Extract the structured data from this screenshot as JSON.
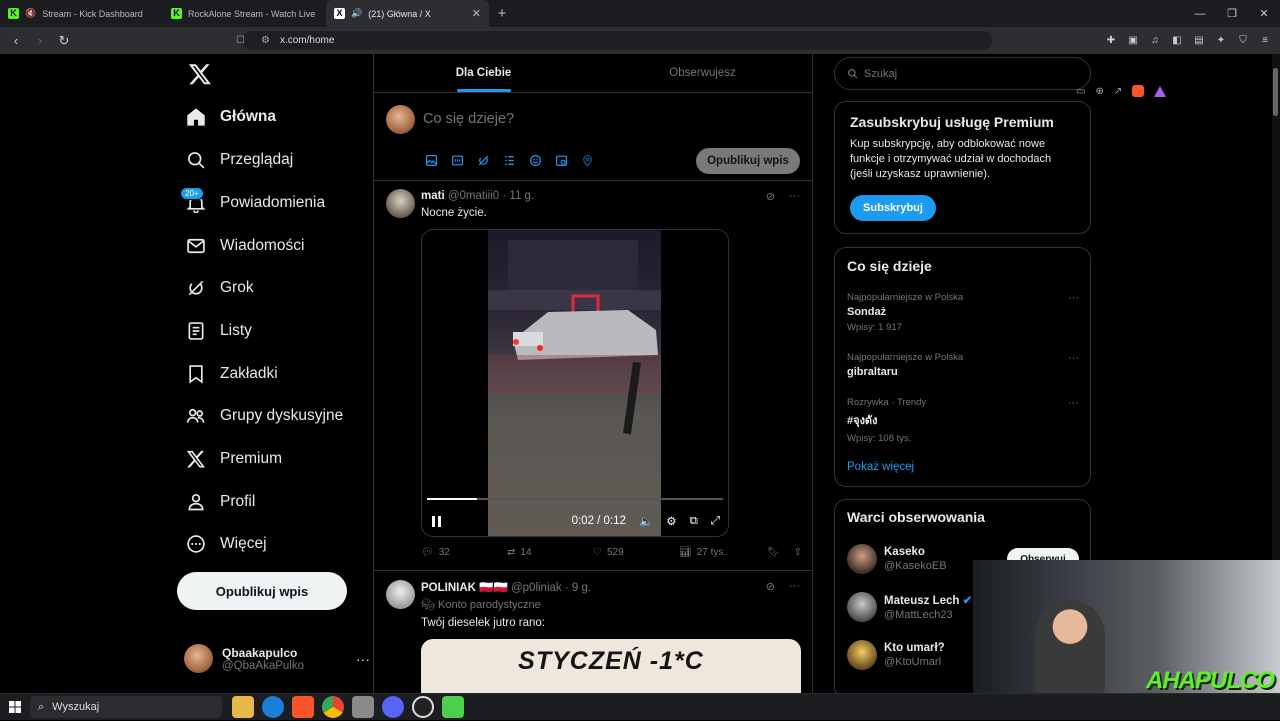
{
  "browser": {
    "tabs": [
      {
        "title": "Stream - Kick Dashboard",
        "active": false
      },
      {
        "title": "RockAlone Stream - Watch Live on K",
        "active": false
      },
      {
        "title": "(21) Główna / X",
        "active": true
      }
    ],
    "url": "x.com/home"
  },
  "sidebar": {
    "items": [
      {
        "label": "Główna",
        "icon": "home-icon"
      },
      {
        "label": "Przeglądaj",
        "icon": "search-icon"
      },
      {
        "label": "Powiadomienia",
        "icon": "bell-icon",
        "badge": "20+"
      },
      {
        "label": "Wiadomości",
        "icon": "mail-icon"
      },
      {
        "label": "Grok",
        "icon": "grok-icon"
      },
      {
        "label": "Listy",
        "icon": "list-icon"
      },
      {
        "label": "Zakładki",
        "icon": "bookmark-icon"
      },
      {
        "label": "Grupy dyskusyjne",
        "icon": "people-icon"
      },
      {
        "label": "Premium",
        "icon": "x-logo-icon"
      },
      {
        "label": "Profil",
        "icon": "person-icon"
      },
      {
        "label": "Więcej",
        "icon": "more-circle-icon"
      }
    ],
    "post_button": "Opublikuj wpis",
    "account": {
      "name": "Qbaakapulco",
      "handle": "@QbaAkaPulko"
    }
  },
  "feed": {
    "tabs": [
      "Dla Ciebie",
      "Obserwujesz"
    ],
    "composer": {
      "placeholder": "Co się dzieje?",
      "post_button": "Opublikuj wpis"
    },
    "tweets": [
      {
        "name": "mati",
        "handle": "@0matiii0",
        "time": "· 11 g.",
        "text": "Nocne życie.",
        "video": {
          "time": "0:02 / 0:12",
          "progress": 0.17
        },
        "stats": {
          "replies": "32",
          "reposts": "14",
          "likes": "529",
          "views": "27 tys."
        }
      },
      {
        "name": "POLINIAK 🇵🇱🇵🇱",
        "handle": "@p0liniak",
        "time": "· 9 g.",
        "label": "Konto parodystyczne",
        "text": "Twój dieselek jutro rano:",
        "image_text": "STYCZEŃ -1*C"
      }
    ]
  },
  "rightbar": {
    "search_placeholder": "Szukaj",
    "premium": {
      "title": "Zasubskrybuj usługę Premium",
      "body": "Kup subskrypcję, aby odblokować nowe funkcje i otrzymywać udział w dochodach (jeśli uzyskasz uprawnienie).",
      "button": "Subskrybuj"
    },
    "trends": {
      "title": "Co się dzieje",
      "items": [
        {
          "category": "Najpopularniejsze w Polska",
          "name": "Sondaż",
          "count": "Wpisy: 1 917"
        },
        {
          "category": "Najpopularniejsze w Polska",
          "name": "gibraltaru",
          "count": ""
        },
        {
          "category": "Rozrywka · Trendy",
          "name": "#จุงดัง",
          "count": "Wpisy: 108 tys."
        }
      ],
      "show_more": "Pokaż więcej"
    },
    "who_to_follow": {
      "title": "Warci obserwowania",
      "users": [
        {
          "name": "Kaseko",
          "handle": "@KasekoEB"
        },
        {
          "name": "Mateusz Lech",
          "handle": "@MattLech23"
        },
        {
          "name": "Kto umarł?",
          "handle": "@KtoUmarl"
        }
      ],
      "follow_button": "Obserwuj"
    }
  },
  "overlay": {
    "brand": "AHAPULCO"
  },
  "taskbar": {
    "search": "Wyszukaj"
  }
}
